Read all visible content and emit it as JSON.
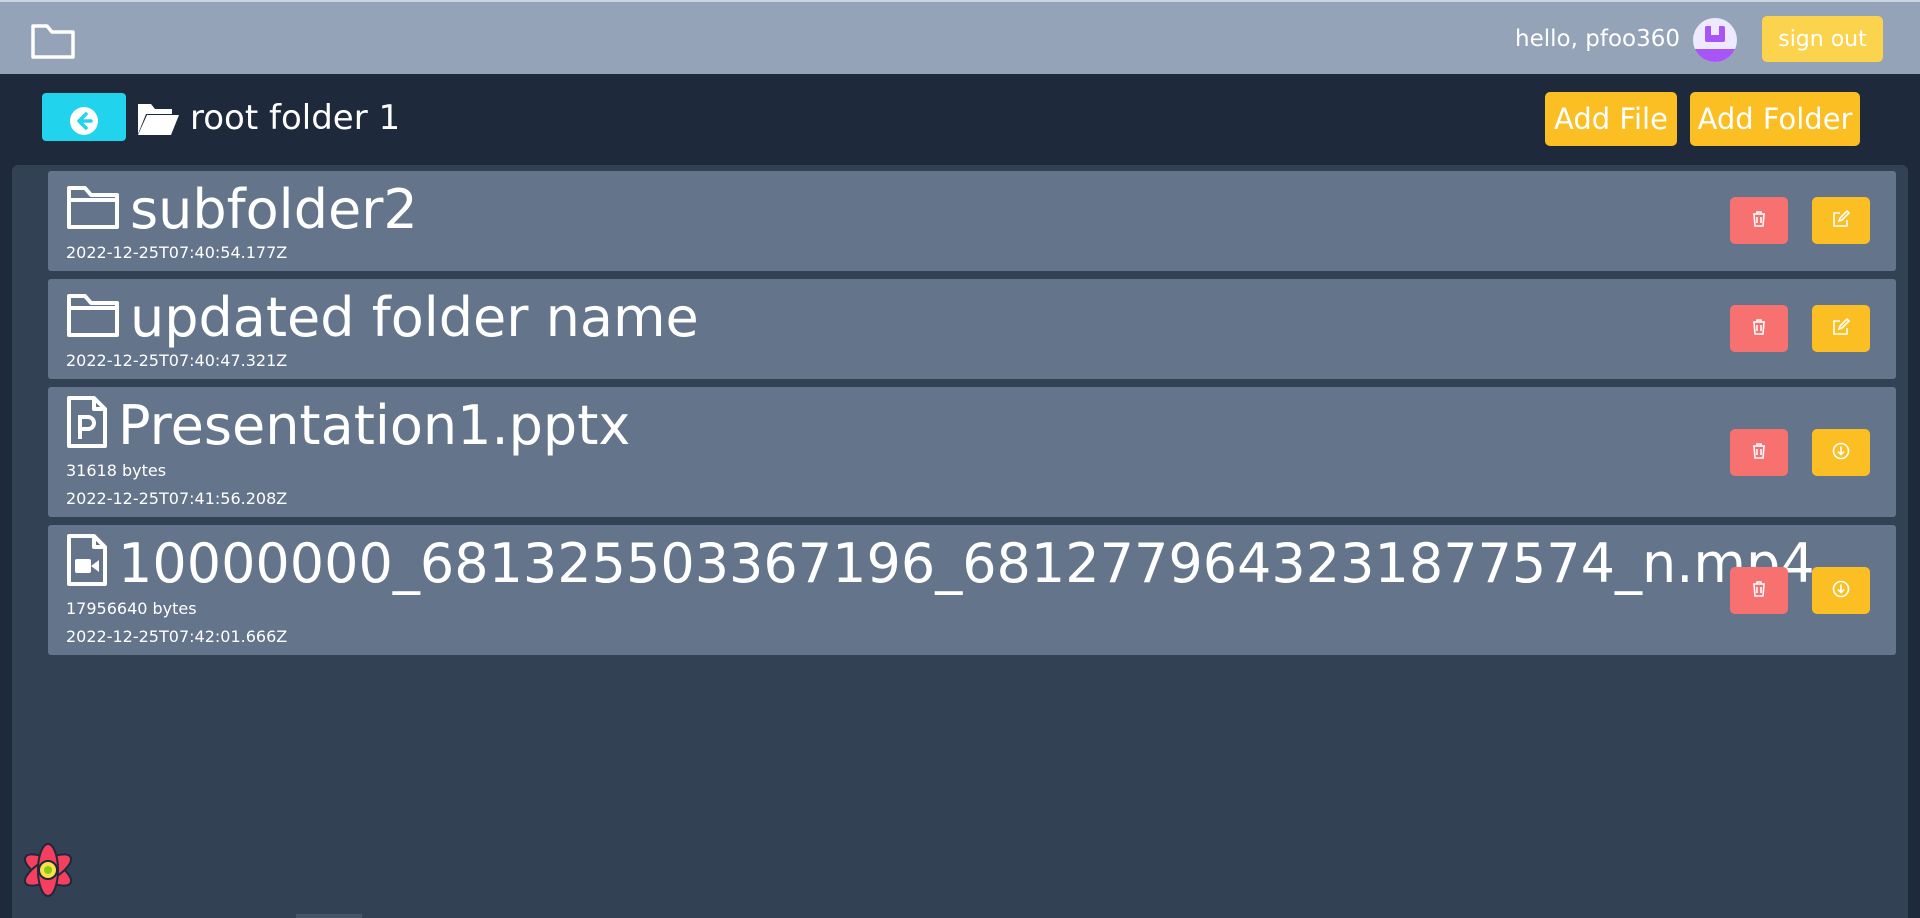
{
  "header": {
    "logo_icon": "folder-outline-icon",
    "greeting": "hello, pfoo360",
    "avatar_icon": "user-avatar-icon",
    "sign_out_label": "sign out"
  },
  "toolbar": {
    "back_icon": "arrow-left-circle-icon",
    "current_folder_icon": "folder-open-icon",
    "current_folder": "root folder 1",
    "add_file_label": "Add File",
    "add_folder_label": "Add Folder"
  },
  "items": [
    {
      "type": "folder",
      "icon": "folder-icon",
      "name": "subfolder2",
      "date": "2022-12-25T07:40:54.177Z",
      "actions": [
        "delete",
        "edit"
      ]
    },
    {
      "type": "folder",
      "icon": "folder-icon",
      "name": "updated folder name",
      "date": "2022-12-25T07:40:47.321Z",
      "actions": [
        "delete",
        "edit"
      ]
    },
    {
      "type": "file",
      "icon": "powerpoint-file-icon",
      "name": "Presentation1.pptx",
      "size": "31618 bytes",
      "date": "2022-12-25T07:41:56.208Z",
      "actions": [
        "delete",
        "download"
      ]
    },
    {
      "type": "file",
      "icon": "video-file-icon",
      "name": "10000000_681325503367196_6812779643231877574_n.mp4",
      "size": "17956640 bytes",
      "date": "2022-12-25T07:42:01.666Z",
      "actions": [
        "delete",
        "download"
      ]
    }
  ],
  "colors": {
    "topbar": "#94a3b8",
    "page_bg": "#1e293b",
    "panel_bg": "#334155",
    "row_bg": "#64748b",
    "accent_yellow": "#fbbf24",
    "delete_red": "#f87171",
    "back_cyan": "#22d3ee"
  }
}
